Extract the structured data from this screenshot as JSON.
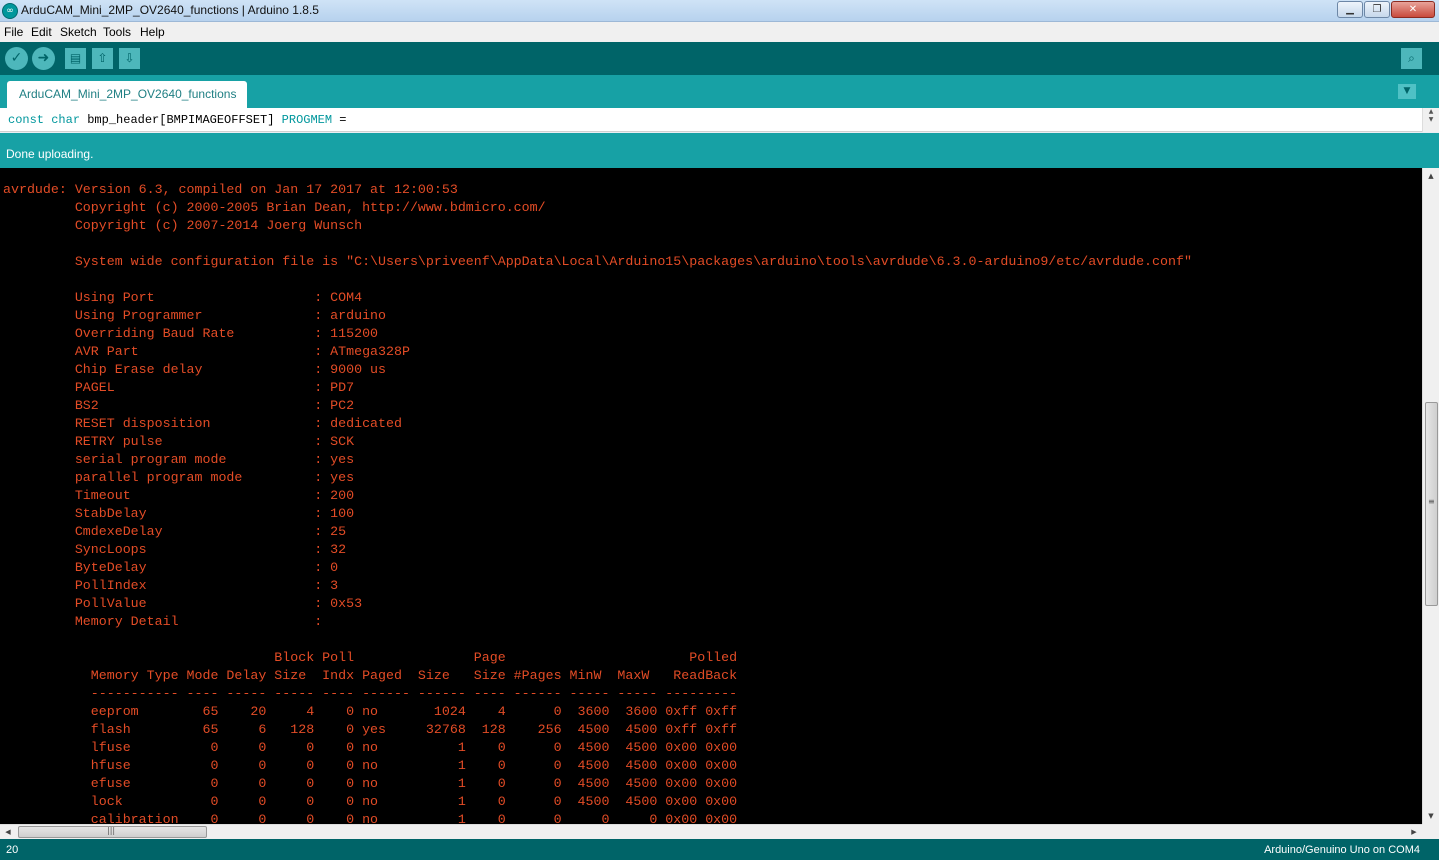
{
  "window": {
    "title": "ArduCAM_Mini_2MP_OV2640_functions | Arduino 1.8.5",
    "buttons": {
      "minimize": "▁",
      "maximize": "❐",
      "close": "✕"
    }
  },
  "menu": [
    "File",
    "Edit",
    "Sketch",
    "Tools",
    "Help"
  ],
  "toolbar": {
    "verify": "✓",
    "upload": "➜",
    "new": "▤",
    "open": "⇧",
    "save": "⇩",
    "serial_monitor": "⌕"
  },
  "tabs": [
    {
      "label": "ArduCAM_Mini_2MP_OV2640_functions",
      "active": true
    }
  ],
  "tab_menu_icon": "▼",
  "editor": {
    "kw_const": "const",
    "kw_char": "char",
    "code": " bmp_header[BMPIMAGEOFFSET] ",
    "kw_progmem": "PROGMEM",
    "tail": " ="
  },
  "status_message": "Done uploading.",
  "console_lines": [
    "avrdude: Version 6.3, compiled on Jan 17 2017 at 12:00:53",
    "         Copyright (c) 2000-2005 Brian Dean, http://www.bdmicro.com/",
    "         Copyright (c) 2007-2014 Joerg Wunsch",
    "",
    "         System wide configuration file is \"C:\\Users\\priveenf\\AppData\\Local\\Arduino15\\packages\\arduino\\tools\\avrdude\\6.3.0-arduino9/etc/avrdude.conf\"",
    "",
    "         Using Port                    : COM4",
    "         Using Programmer              : arduino",
    "         Overriding Baud Rate          : 115200",
    "         AVR Part                      : ATmega328P",
    "         Chip Erase delay              : 9000 us",
    "         PAGEL                         : PD7",
    "         BS2                           : PC2",
    "         RESET disposition             : dedicated",
    "         RETRY pulse                   : SCK",
    "         serial program mode           : yes",
    "         parallel program mode         : yes",
    "         Timeout                       : 200",
    "         StabDelay                     : 100",
    "         CmdexeDelay                   : 25",
    "         SyncLoops                     : 32",
    "         ByteDelay                     : 0",
    "         PollIndex                     : 3",
    "         PollValue                     : 0x53",
    "         Memory Detail                 :",
    "",
    "                                  Block Poll               Page                       Polled",
    "           Memory Type Mode Delay Size  Indx Paged  Size   Size #Pages MinW  MaxW   ReadBack",
    "           ----------- ---- ----- ----- ---- ------ ------ ---- ------ ----- ----- ---------",
    "           eeprom        65    20     4    0 no       1024    4      0  3600  3600 0xff 0xff",
    "           flash         65     6   128    0 yes     32768  128    256  4500  4500 0xff 0xff",
    "           lfuse          0     0     0    0 no          1    0      0  4500  4500 0x00 0x00",
    "           hfuse          0     0     0    0 no          1    0      0  4500  4500 0x00 0x00",
    "           efuse          0     0     0    0 no          1    0      0  4500  4500 0x00 0x00",
    "           lock           0     0     0    0 no          1    0      0  4500  4500 0x00 0x00",
    "           calibration    0     0     0    0 no          1    0      0     0     0 0x00 0x00"
  ],
  "scrollbar_grip": "≡",
  "footer": {
    "line_number": "20",
    "board": "Arduino/Genuino Uno on COM4"
  },
  "colors": {
    "toolbar": "#006468",
    "tabbar": "#17a1a5",
    "console_bg": "#000000",
    "console_text": "#e34c26",
    "keyword": "#00979d"
  }
}
